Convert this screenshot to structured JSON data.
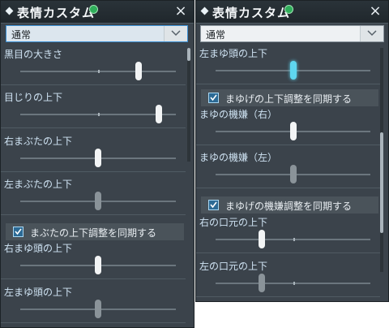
{
  "left_panel": {
    "title": "表情カスタム",
    "close": "×",
    "preset": "通常",
    "sliders": [
      {
        "label": "黒目の大きさ",
        "value": 0.76,
        "state": "normal"
      },
      {
        "label": "目じりの上下",
        "value": 0.89,
        "state": "normal"
      },
      {
        "label": "右まぶたの上下",
        "value": 0.5,
        "state": "normal"
      },
      {
        "label": "左まぶたの上下",
        "value": 0.5,
        "state": "dim"
      }
    ],
    "checkbox": {
      "label": "まぶたの上下調整を同期する",
      "checked": true
    },
    "sliders_after": [
      {
        "label": "右まゆ頭の上下",
        "value": 0.5,
        "state": "normal"
      },
      {
        "label": "左まゆ頭の上下",
        "value": 0.5,
        "state": "dim"
      }
    ]
  },
  "right_panel": {
    "title": "表情カスタム",
    "close": "×",
    "preset": "通常",
    "slider_top": {
      "label": "左まゆ頭の上下",
      "value": 0.5,
      "state": "active"
    },
    "checkbox1": {
      "label": "まゆげの上下調整を同期する",
      "checked": true
    },
    "sliders_mid": [
      {
        "label": "まゆの機嫌（右）",
        "value": 0.5,
        "state": "normal"
      },
      {
        "label": "まゆの機嫌（左）",
        "value": 0.5,
        "state": "dim"
      }
    ],
    "checkbox2": {
      "label": "まゆげの機嫌調整を同期する",
      "checked": true
    },
    "sliders_bottom": [
      {
        "label": "右の口元の上下",
        "value": 0.3,
        "state": "normal"
      },
      {
        "label": "左の口元の上下",
        "value": 0.3,
        "state": "dim"
      }
    ]
  },
  "colors": {
    "panel_bg": "#3b434b",
    "label_text": "#cfe3f3",
    "active_thumb": "#5fd7f0",
    "checkbox_fill": "#2c6a95"
  }
}
